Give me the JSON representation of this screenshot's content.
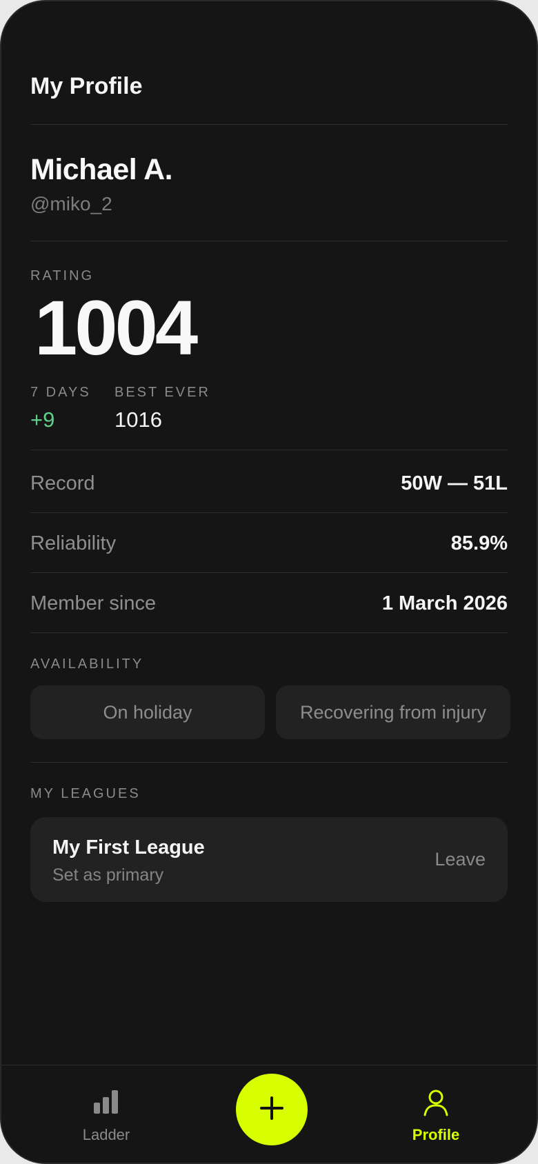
{
  "header": {
    "title": "My Profile"
  },
  "profile": {
    "name": "Michael A.",
    "handle": "@miko_2"
  },
  "rating": {
    "label": "RATING",
    "value": "1004",
    "seven_days_label": "7 DAYS",
    "seven_days_value": "+9",
    "best_ever_label": "BEST EVER",
    "best_ever_value": "1016"
  },
  "details": [
    {
      "key": "Record",
      "value": "50W — 51L"
    },
    {
      "key": "Reliability",
      "value": "85.9%"
    },
    {
      "key": "Member since",
      "value": "1 March 2026"
    }
  ],
  "availability": {
    "label": "AVAILABILITY",
    "options": [
      "On holiday",
      "Recovering from injury"
    ]
  },
  "leagues": {
    "label": "MY LEAGUES",
    "items": [
      {
        "name": "My First League",
        "sub": "Set as primary",
        "action": "Leave"
      }
    ]
  },
  "tabbar": {
    "items": [
      {
        "label": "Ladder",
        "icon": "bar-chart-icon",
        "active": false
      },
      {
        "label": "Profile",
        "icon": "user-icon",
        "active": true
      }
    ],
    "fab_icon": "plus-icon"
  },
  "colors": {
    "accent": "#d7ff00",
    "positive": "#5ed08a",
    "background": "#151515",
    "card": "#222222"
  }
}
